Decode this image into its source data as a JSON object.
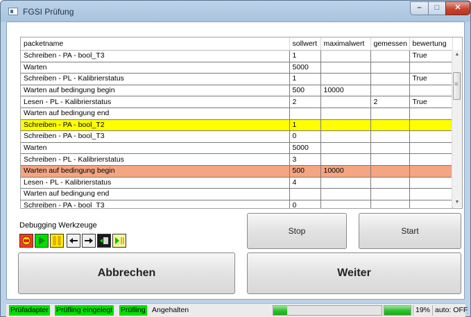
{
  "window": {
    "title": "FGSI Prüfung",
    "minimize": "–",
    "maximize": "□",
    "close": "✕"
  },
  "grid": {
    "columns": [
      "packetname",
      "sollwert",
      "maximalwert",
      "gemessen",
      "bewertung"
    ],
    "rows": [
      [
        "Schreiben - PA - bool_T3",
        "1",
        "",
        "",
        "True"
      ],
      [
        "Warten",
        "5000",
        "",
        "",
        ""
      ],
      [
        "Schreiben - PL - Kalibrierstatus",
        "1",
        "",
        "",
        "True"
      ],
      [
        "Warten auf bedingung begin",
        "500",
        "10000",
        "",
        ""
      ],
      [
        "Lesen - PL - Kalibrierstatus",
        "2",
        "",
        "2",
        "True"
      ],
      [
        "Warten auf bedingung end",
        "",
        "",
        "",
        ""
      ],
      [
        "Schreiben - PA - bool_T2",
        "1",
        "",
        "",
        ""
      ],
      [
        "Schreiben - PA - bool_T3",
        "0",
        "",
        "",
        ""
      ],
      [
        "Warten",
        "5000",
        "",
        "",
        ""
      ],
      [
        "Schreiben - PL - Kalibrierstatus",
        "3",
        "",
        "",
        ""
      ],
      [
        "Warten auf bedingung begin",
        "500",
        "10000",
        "",
        ""
      ],
      [
        "Lesen - PL - Kalibrierstatus",
        "4",
        "",
        "",
        ""
      ],
      [
        "Warten auf bedingung end",
        "",
        "",
        "",
        ""
      ],
      [
        "Schreiben - PA - bool_T3",
        "0",
        "",
        "",
        ""
      ]
    ],
    "highlight_yellow_row": 6,
    "highlight_orange_row": 10
  },
  "debug": {
    "label": "Debugging Werkzeuge",
    "tools": [
      "stop-record-icon",
      "play-icon",
      "pause-icon",
      "arrow-left-icon",
      "arrow-right-icon",
      "step-into-icon",
      "step-over-icon"
    ]
  },
  "buttons": {
    "stop": "Stop",
    "start": "Start",
    "abbrechen": "Abbrechen",
    "weiter": "Weiter"
  },
  "status": {
    "pruefadapter": "Prüfadapter",
    "pruefling_eingelegt": "Prüfling eingelegt",
    "pruefling": "Prüfling",
    "state": "Angehalten",
    "progress_percent": "19%",
    "progress_fraction": 0.19,
    "auto": "auto: OFF"
  },
  "colors": {
    "status_green": "#00e000",
    "row_yellow": "#ffff00",
    "row_orange": "#f4a582"
  }
}
